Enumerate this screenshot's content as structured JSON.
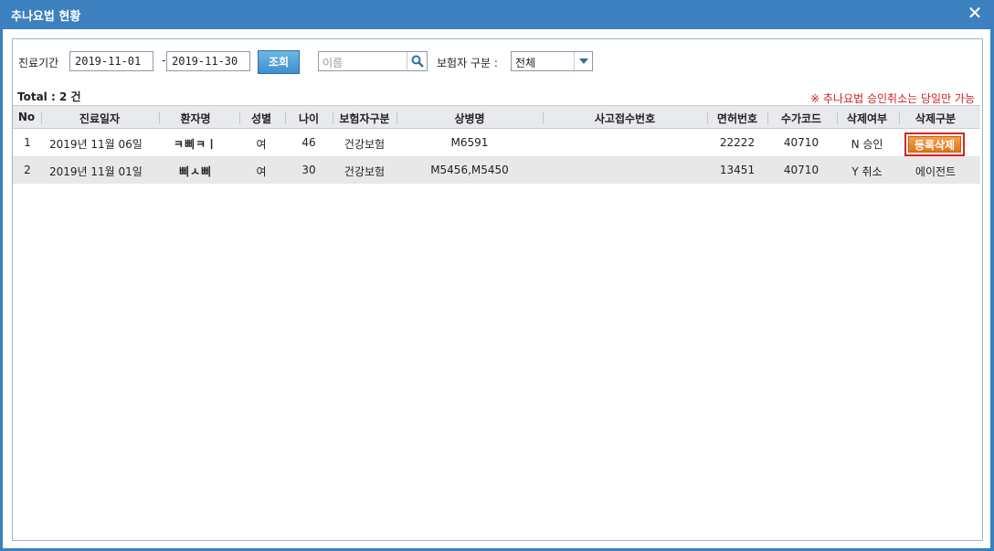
{
  "window": {
    "title": "추나요법 현황",
    "close_glyph": "✕"
  },
  "filters": {
    "period_label": "진료기간",
    "date_from": "2019-11-01",
    "date_sep": "-",
    "date_to": "2019-11-30",
    "search_button": "조회",
    "name_placeholder": "이름",
    "insurer_label": "보험자 구분 :",
    "insurer_selected": "전체"
  },
  "summary": {
    "total_label": "Total :",
    "total_value": "2 건",
    "notice": "※ 추나요법 승인취소는 당일만 가능"
  },
  "table": {
    "headers": [
      "No",
      "진료일자",
      "환자명",
      "성별",
      "나이",
      "보험자구분",
      "상병명",
      "사고접수번호",
      "면허번호",
      "수가코드",
      "삭제여부",
      "삭제구분"
    ],
    "rows": [
      {
        "no": "1",
        "date": "2019년 11월 06일",
        "name": "ㅋ삐ㅋㅣ",
        "sex": "여",
        "age": "46",
        "insurer": "건강보험",
        "disease": "M6591",
        "accident": "",
        "license": "22222",
        "code": "40710",
        "deleted": "N 승인",
        "action": "등록삭제"
      },
      {
        "no": "2",
        "date": "2019년 11월 01일",
        "name": "삐ㅅ삐",
        "sex": "여",
        "age": "30",
        "insurer": "건강보험",
        "disease": "M5456,M5450",
        "accident": "",
        "license": "13451",
        "code": "40710",
        "deleted": "Y 취소",
        "action": "에이전트"
      }
    ]
  },
  "colors": {
    "accent": "#3d80bf",
    "notice": "#d12020",
    "delete_button": "#e0741a"
  }
}
